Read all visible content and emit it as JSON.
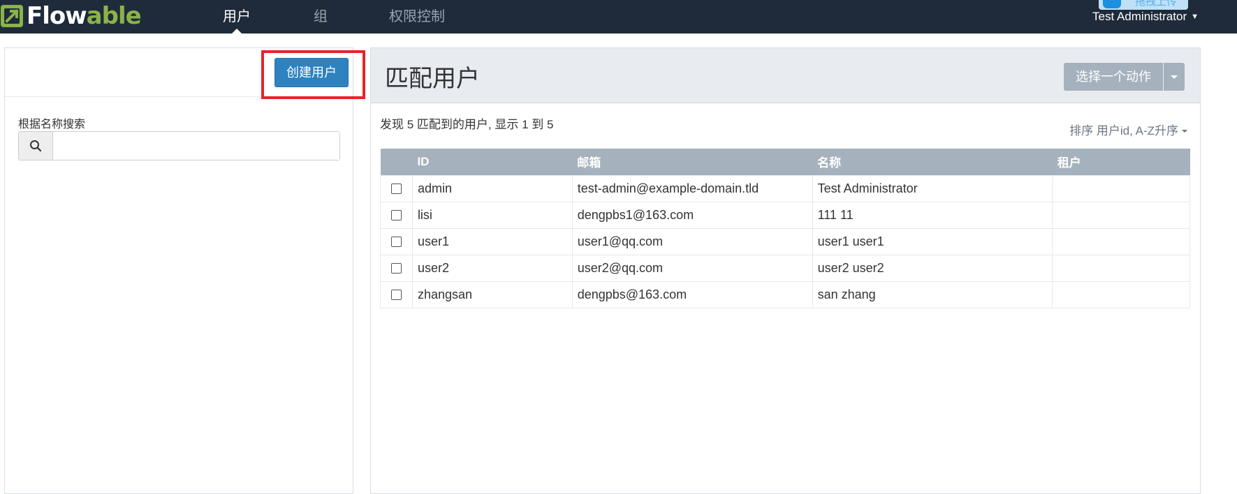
{
  "app": {
    "logo_text_flow": "Flow",
    "logo_text_able": "able",
    "brand_color": "#8ab34a"
  },
  "nav": {
    "items": [
      {
        "label": "用户",
        "active": true
      },
      {
        "label": "组",
        "active": false
      },
      {
        "label": "权限控制",
        "active": false
      }
    ],
    "upload_chip_label": "拖拽上传",
    "user_menu_label": "Test Administrator"
  },
  "left": {
    "create_button_label": "创建用户",
    "search_label": "根据名称搜索",
    "search_value": "",
    "search_placeholder": ""
  },
  "right": {
    "title": "匹配用户",
    "action_button_label": "选择一个动作",
    "summary": "发现 5 匹配到的用户, 显示 1 到 5",
    "sort_label": "排序 用户id, A-Z升序",
    "columns": [
      "ID",
      "邮箱",
      "名称",
      "租户"
    ],
    "rows": [
      {
        "id": "admin",
        "email": "test-admin@example-domain.tld",
        "name": "Test Administrator",
        "tenant": ""
      },
      {
        "id": "lisi",
        "email": "dengpbs1@163.com",
        "name": "111 11",
        "tenant": ""
      },
      {
        "id": "user1",
        "email": "user1@qq.com",
        "name": "user1 user1",
        "tenant": ""
      },
      {
        "id": "user2",
        "email": "user2@qq.com",
        "name": "user2 user2",
        "tenant": ""
      },
      {
        "id": "zhangsan",
        "email": "dengpbs@163.com",
        "name": "san zhang",
        "tenant": ""
      }
    ]
  },
  "colors": {
    "navbar_bg": "#1f2b3a",
    "primary_button": "#2e82c0",
    "table_header": "#a5b2bd",
    "highlight": "#e8232a"
  },
  "icons": {
    "search": "search-icon",
    "user_menu_chevron": "chevron-down-icon",
    "action_caret": "caret-down-icon",
    "sort_caret": "caret-down-icon"
  }
}
